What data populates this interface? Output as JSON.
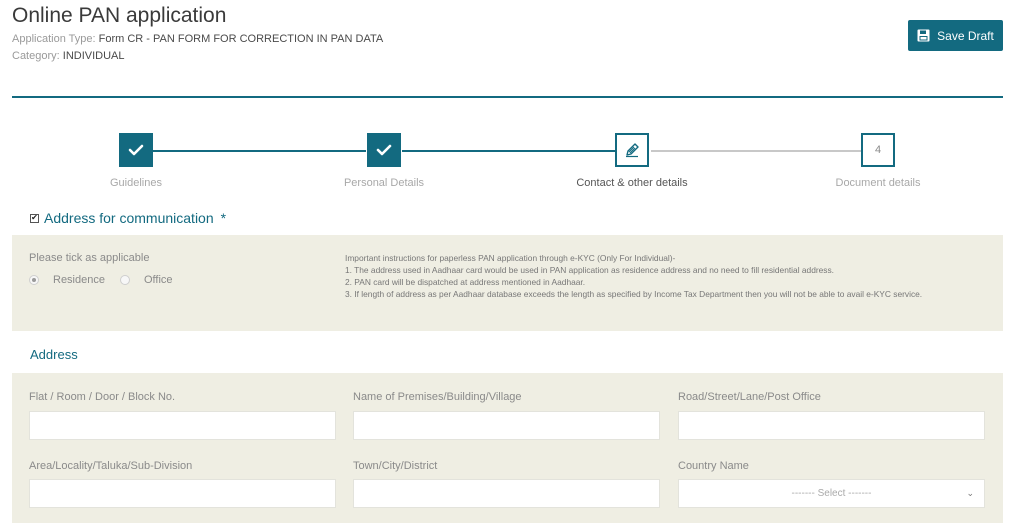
{
  "header": {
    "title": "Online PAN application",
    "application_type_label": "Application Type:",
    "application_type_value": "Form CR - PAN FORM FOR CORRECTION IN PAN DATA",
    "category_label": "Category:",
    "category_value": "INDIVIDUAL",
    "save_label": "Save Draft"
  },
  "stepper": {
    "steps": [
      {
        "label": "Guidelines",
        "status": "completed"
      },
      {
        "label": "Personal Details",
        "status": "completed"
      },
      {
        "label": "Contact & other details",
        "status": "current"
      },
      {
        "label": "Document details",
        "status": "pending",
        "number": "4"
      }
    ]
  },
  "communication": {
    "title": "Address for communication",
    "required_mark": "*",
    "checked": true,
    "tick_label": "Please tick as applicable",
    "options": [
      {
        "label": "Residence",
        "selected": true
      },
      {
        "label": "Office",
        "selected": false
      }
    ],
    "instructions": [
      "Important instructions for paperless PAN application through e-KYC (Only For Individual)-",
      "1. The address used in Aadhaar card would be used in PAN application as residence address and no need to fill residential address.",
      "2. PAN card will be dispatched at address mentioned in Aadhaar.",
      "3. If length of address as per Aadhaar database exceeds the length as specified by Income Tax Department then you will not be able to avail e-KYC service."
    ]
  },
  "address": {
    "heading": "Address",
    "fields": {
      "flat": {
        "label": "Flat / Room / Door / Block No.",
        "value": ""
      },
      "premises": {
        "label": "Name of Premises/Building/Village",
        "value": ""
      },
      "road": {
        "label": "Road/Street/Lane/Post Office",
        "value": ""
      },
      "area": {
        "label": "Area/Locality/Taluka/Sub-Division",
        "value": ""
      },
      "town": {
        "label": "Town/City/District",
        "value": ""
      },
      "country": {
        "label": "Country Name",
        "selected": "------- Select -------"
      }
    }
  },
  "colors": {
    "accent": "#136a80",
    "panel_background": "#efeee3"
  },
  "icons": {
    "save": "floppy-disk-icon",
    "completed_step": "checkmark-icon",
    "current_step": "pencil-icon",
    "select": "chevron-down-icon"
  }
}
